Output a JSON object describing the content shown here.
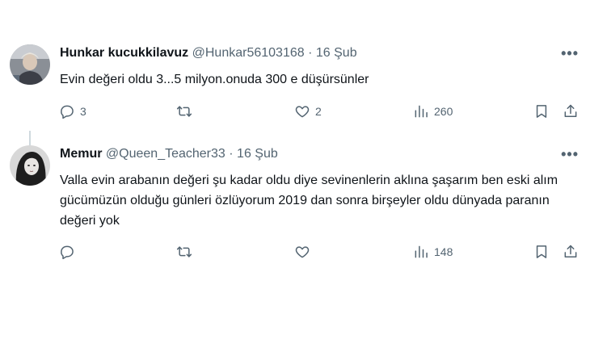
{
  "tweets": [
    {
      "name": "Hunkar kucukkilavuz",
      "handle": "@Hunkar56103168",
      "sep": "·",
      "date": "16 Şub",
      "text": "Evin değeri oldu 3...5 milyon.onuda 300 e düşürsünler",
      "more": "•••",
      "replies": "3",
      "retweets": "",
      "likes": "2",
      "views": "260"
    },
    {
      "name": "Memur",
      "handle": "@Queen_Teacher33",
      "sep": "·",
      "date": "16 Şub",
      "text": "Valla evin arabanın değeri şu kadar oldu diye sevinenlerin aklına şaşarım ben eski alım gücümüzün olduğu günleri özlüyorum 2019 dan sonra birşeyler oldu dünyada paranın değeri yok",
      "more": "•••",
      "replies": "",
      "retweets": "",
      "likes": "",
      "views": "148"
    }
  ],
  "icons": [
    "reply-icon",
    "retweet-icon",
    "like-icon",
    "views-icon",
    "bookmark-icon",
    "share-icon"
  ],
  "colors": {
    "text": "#0f1419",
    "muted": "#536471",
    "line": "#cfd9de"
  }
}
